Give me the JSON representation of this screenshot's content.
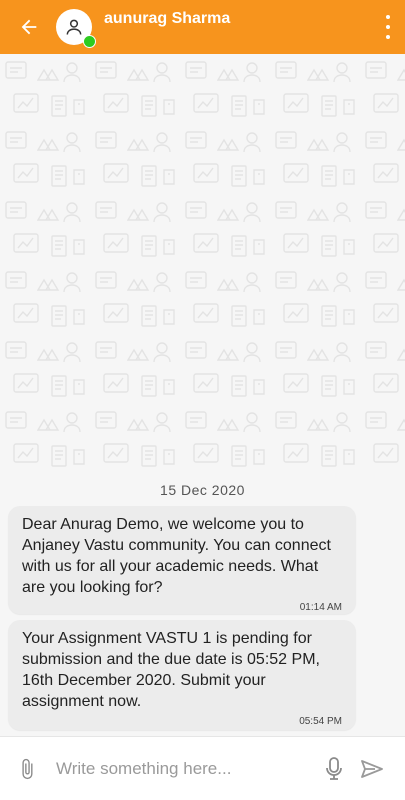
{
  "header": {
    "contact_name": "aunurag Sharma",
    "accent_color": "#f7941d",
    "online_status_color": "#2ecc1f",
    "icons": [
      "back-arrow-icon",
      "person-icon",
      "more-vert-icon"
    ]
  },
  "chat": {
    "date_separator": "15  Dec  2020",
    "messages": [
      {
        "text": "Dear Anurag Demo, we welcome you to Anjaney Vastu community. You can connect with us for all your academic needs. What are you looking for?",
        "time": "01:14 AM"
      },
      {
        "text": "Your Assignment VASTU 1 is pending for submission and the due date is 05:52 PM, 16th December 2020. Submit your assignment now.",
        "time": "05:54 PM"
      }
    ]
  },
  "composer": {
    "placeholder": "Write something here...",
    "icons": [
      "paperclip-icon",
      "mic-icon",
      "send-icon"
    ]
  }
}
